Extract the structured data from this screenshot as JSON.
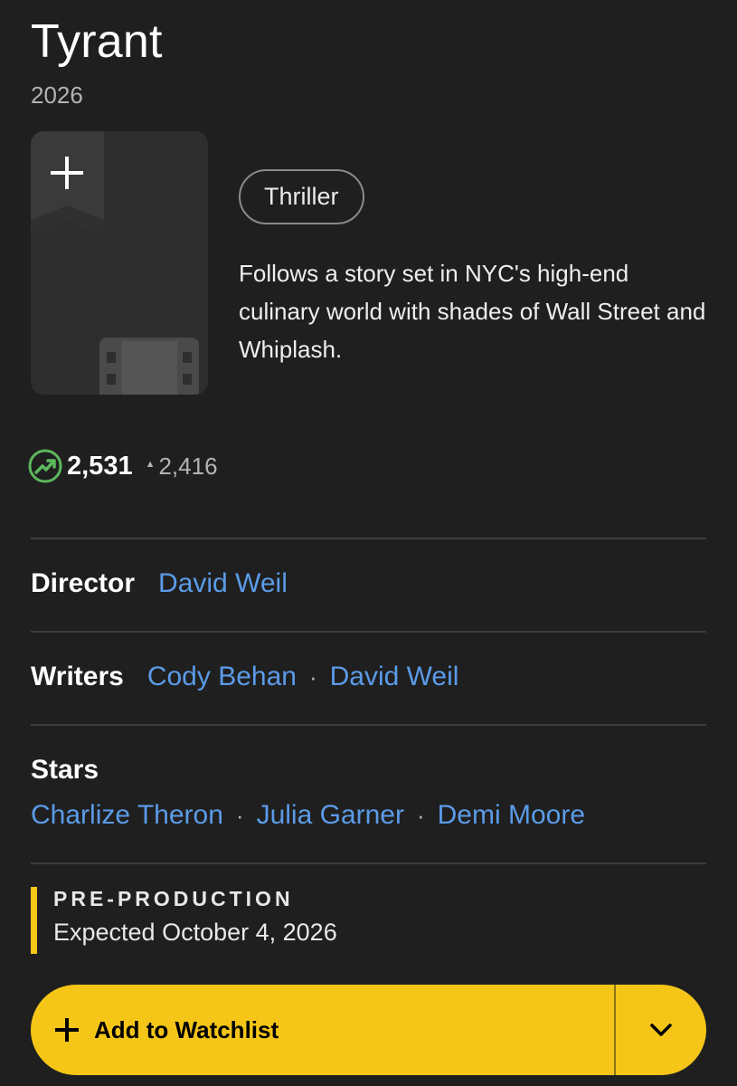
{
  "title": "Tyrant",
  "year": "2026",
  "genre": "Thriller",
  "plot": "Follows a story set in NYC's high-end culinary world with shades of Wall Street and Whiplash.",
  "popularity": {
    "value": "2,531",
    "delta": "2,416",
    "icon": "trending-up-icon",
    "accent": "#5cb85c"
  },
  "credits": {
    "director_label": "Director",
    "director": [
      "David Weil"
    ],
    "writers_label": "Writers",
    "writers": [
      "Cody Behan",
      "David Weil"
    ],
    "stars_label": "Stars",
    "stars": [
      "Charlize Theron",
      "Julia Garner",
      "Demi Moore"
    ],
    "separator": "·"
  },
  "status": {
    "stage": "PRE-PRODUCTION",
    "expected": "Expected October 4, 2026",
    "accent": "#f5c518"
  },
  "watchlist_button": {
    "label": "Add to Watchlist",
    "color": "#f5c518"
  },
  "colors": {
    "background": "#1f1f1f",
    "link": "#5b9be8",
    "brand": "#f5c518"
  }
}
